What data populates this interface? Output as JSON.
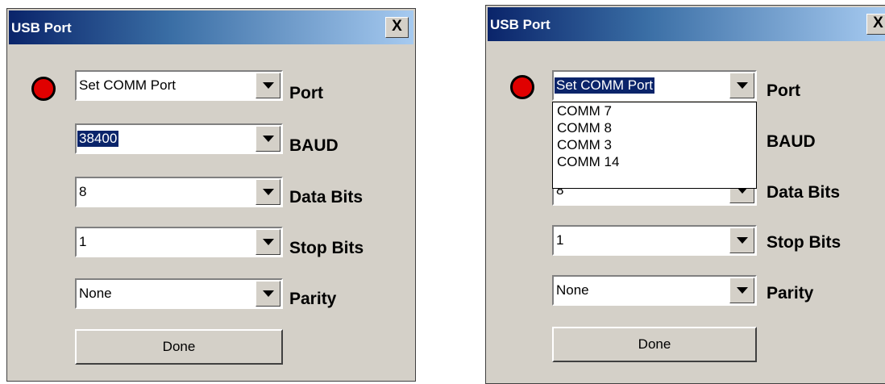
{
  "left_dialog": {
    "title": "USB Port",
    "close_glyph": "X",
    "status_led_color": "#e00000",
    "port": {
      "value": "Set COMM Port",
      "label": "Port"
    },
    "baud": {
      "value": "38400",
      "label": "BAUD"
    },
    "data_bits": {
      "value": "8",
      "label": "Data Bits"
    },
    "stop_bits": {
      "value": "1",
      "label": "Stop Bits"
    },
    "parity": {
      "value": "None",
      "label": "Parity"
    },
    "done_label": "Done"
  },
  "right_dialog": {
    "title": "USB Port",
    "close_glyph": "X",
    "status_led_color": "#e00000",
    "port": {
      "value": "Set COMM Port",
      "label": "Port"
    },
    "port_dropdown_options": [
      "COMM 7",
      "COMM 8",
      "COMM 3",
      "COMM 14"
    ],
    "baud": {
      "label": "BAUD"
    },
    "data_bits": {
      "value": "8",
      "label": "Data Bits"
    },
    "stop_bits": {
      "value": "1",
      "label": "Stop Bits"
    },
    "parity": {
      "value": "None",
      "label": "Parity"
    },
    "done_label": "Done"
  }
}
